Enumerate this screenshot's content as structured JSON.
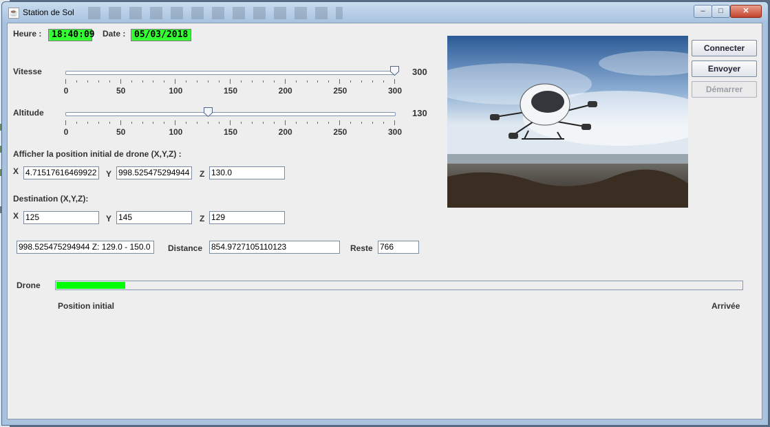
{
  "window": {
    "title": "Station de Sol",
    "controls": {
      "minimize": "–",
      "maximize": "□",
      "close": "✕"
    }
  },
  "header": {
    "heure_label": "Heure :",
    "heure_value": "18:40:09",
    "date_label": "Date :",
    "date_value": "05/03/2018"
  },
  "vitesse": {
    "label": "Vitesse",
    "value": 300,
    "value_text": "300",
    "min": 0,
    "max": 300,
    "ticks": [
      "0",
      "50",
      "100",
      "150",
      "200",
      "250",
      "300"
    ]
  },
  "altitude": {
    "label": "Altitude",
    "value": 130,
    "value_text": "130",
    "min": 0,
    "max": 300,
    "ticks": [
      "0",
      "50",
      "100",
      "150",
      "200",
      "250",
      "300"
    ]
  },
  "position": {
    "section_label": "Afficher la position initial de drone (X,Y,Z) :",
    "x_label": "X",
    "x_value": "4.71517616469922",
    "y_label": "Y",
    "y_value": "998.525475294944",
    "z_label": "Z",
    "z_value": "130.0"
  },
  "destination": {
    "section_label": "Destination (X,Y,Z):",
    "x_label": "X",
    "x_value": "125",
    "y_label": "Y",
    "y_value": "145",
    "z_label": "Z",
    "z_value": "129"
  },
  "info": {
    "summary_value": "998.525475294944 Z: 129.0 - 150.0",
    "distance_label": "Distance",
    "distance_value": "854.9727105110123",
    "reste_label": "Reste",
    "reste_value": "766"
  },
  "buttons": {
    "connecter": "Connecter",
    "envoyer": "Envoyer",
    "demarrer": "Démarrer"
  },
  "progress": {
    "label": "Drone",
    "fraction": 0.1,
    "start_label": "Position initial",
    "end_label": "Arrivée"
  },
  "colors": {
    "clock_field": "#33ff33",
    "progress_fill": "#00ff00"
  }
}
